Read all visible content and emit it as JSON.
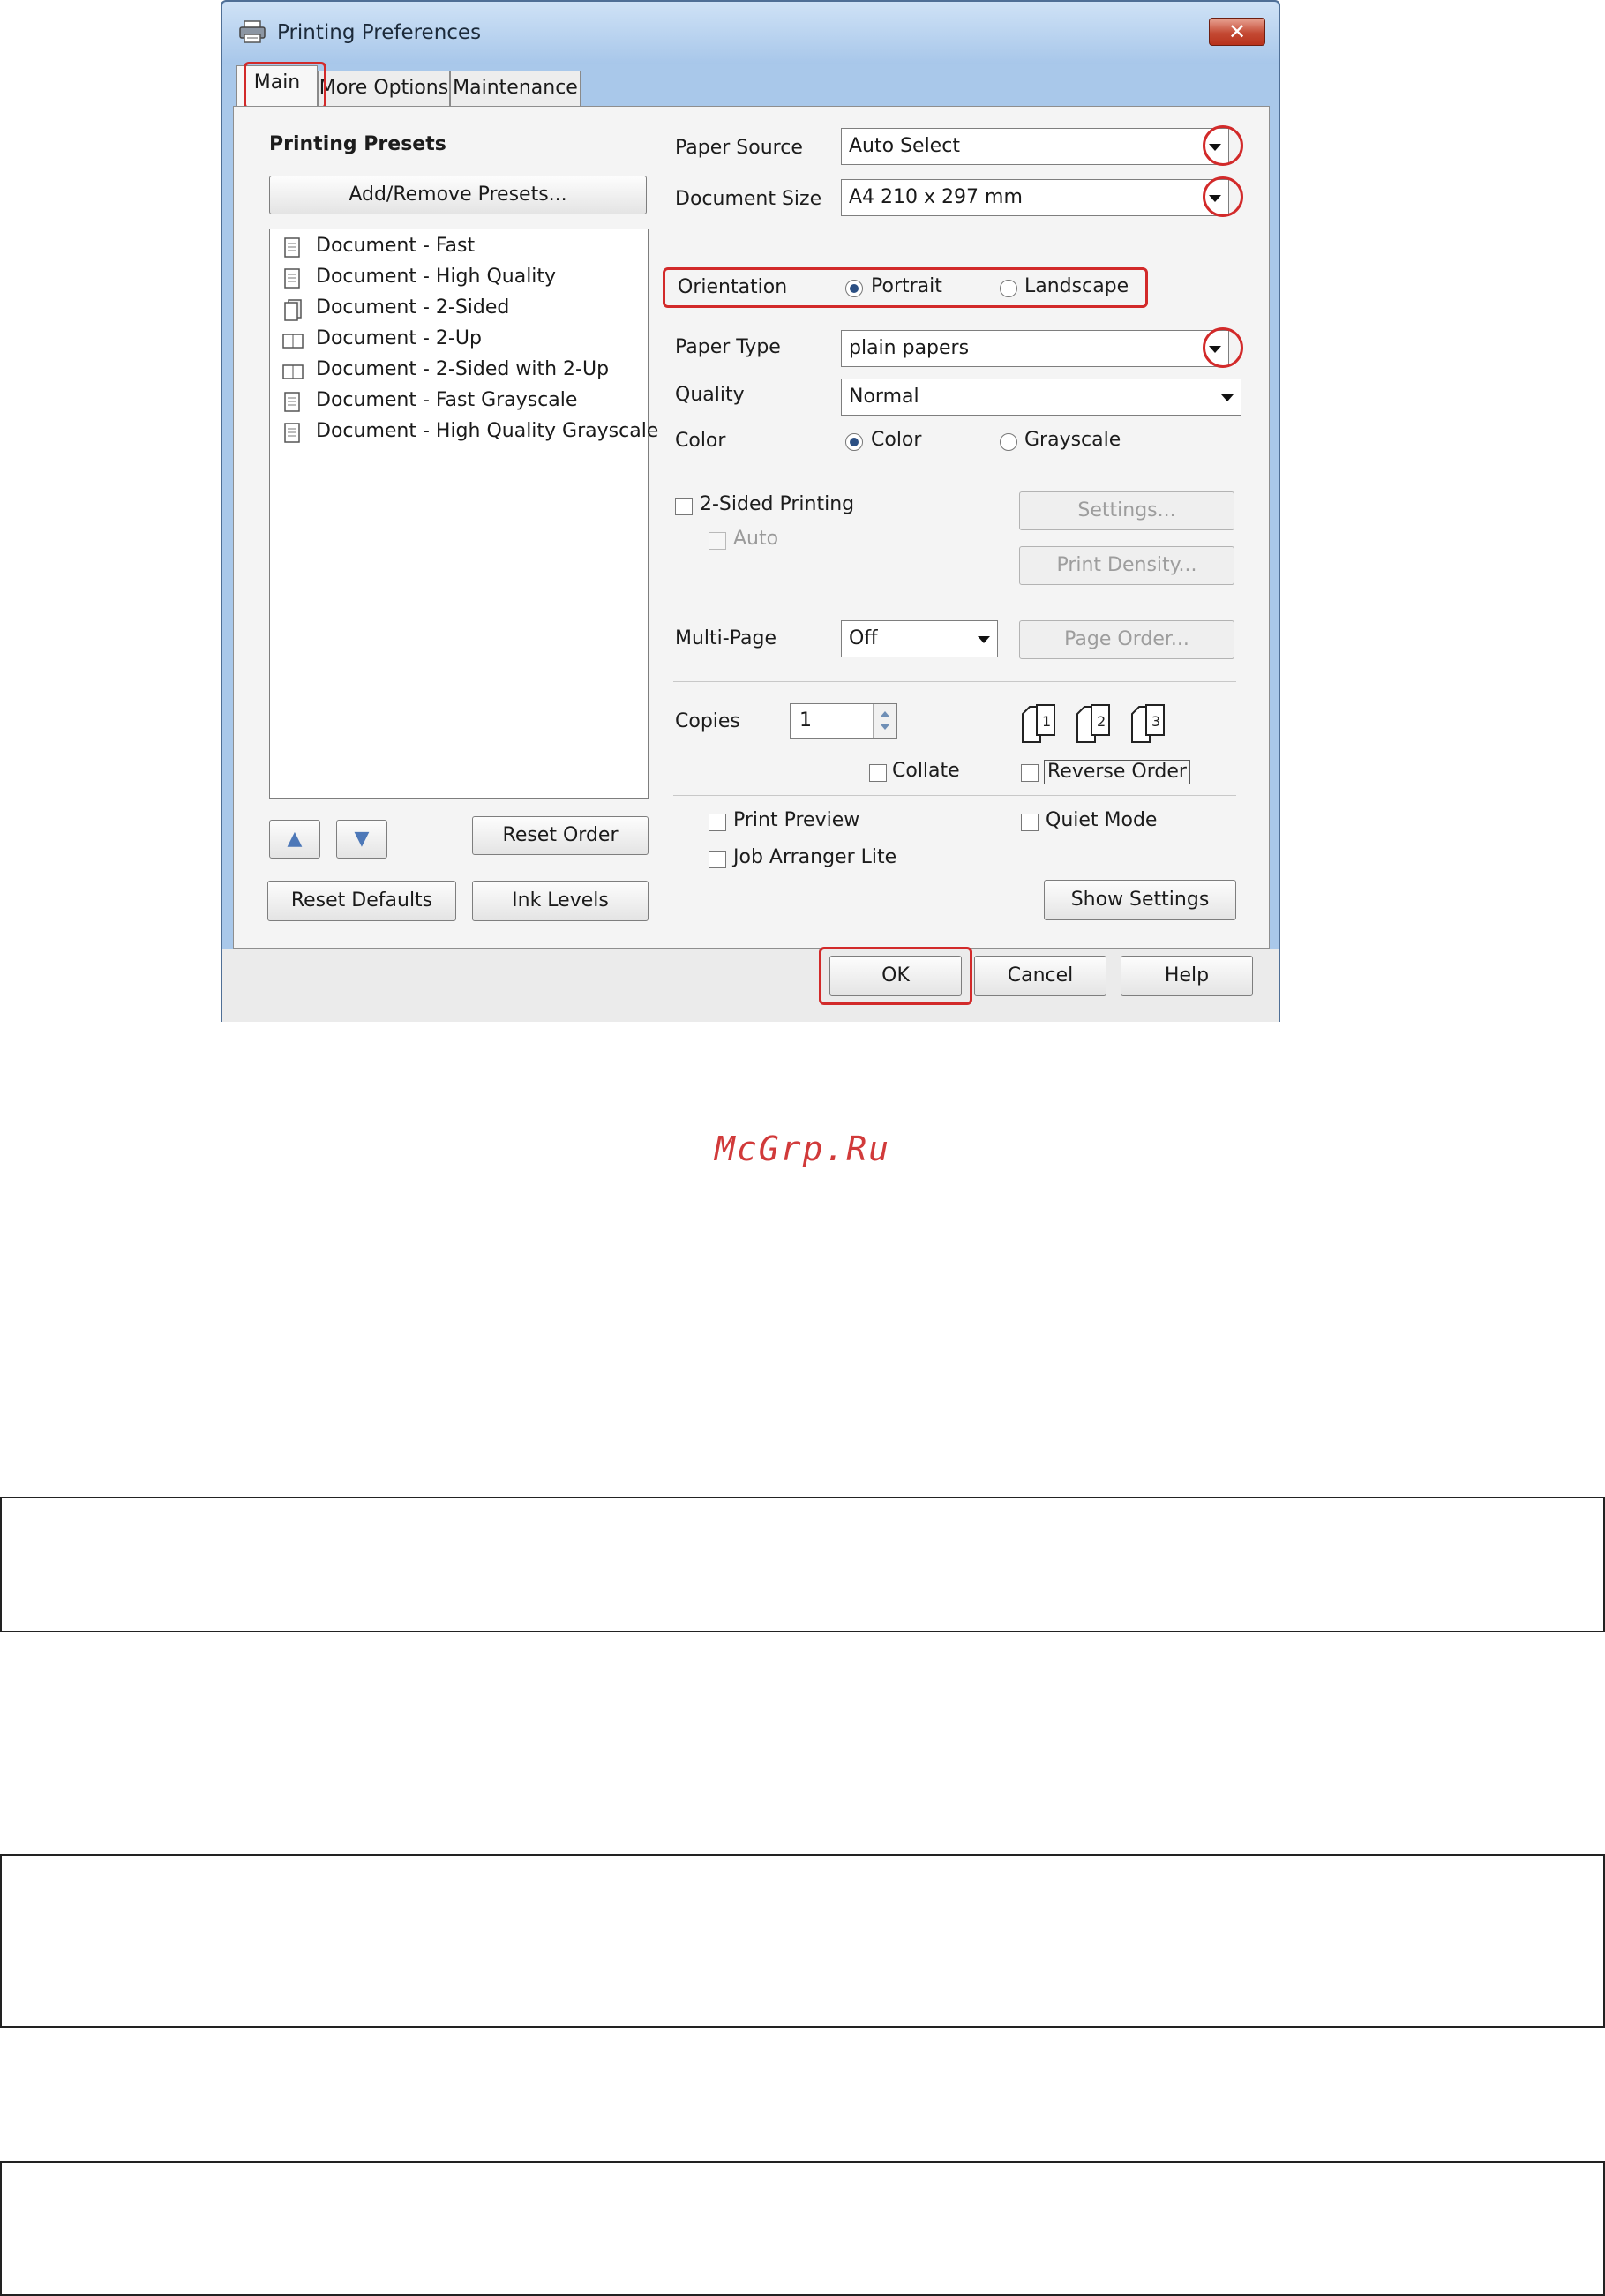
{
  "window": {
    "title": "Printing Preferences",
    "close_glyph": "✕",
    "close_color": "#c44a34",
    "highlight_color": "#d22a2a"
  },
  "tabs": [
    {
      "label": "Main",
      "active": true
    },
    {
      "label": "More Options",
      "active": false
    },
    {
      "label": "Maintenance",
      "active": false
    }
  ],
  "presets": {
    "heading": "Printing Presets",
    "add_remove_label": "Add/Remove Presets...",
    "items": [
      {
        "label": "Document - Fast",
        "icon": "document-icon"
      },
      {
        "label": "Document - High Quality",
        "icon": "document-icon"
      },
      {
        "label": "Document - 2-Sided",
        "icon": "two-sided-icon"
      },
      {
        "label": "Document - 2-Up",
        "icon": "two-up-icon"
      },
      {
        "label": "Document - 2-Sided with 2-Up",
        "icon": "two-up-icon"
      },
      {
        "label": "Document - Fast Grayscale",
        "icon": "document-icon"
      },
      {
        "label": "Document - High Quality Grayscale",
        "icon": "document-icon"
      }
    ],
    "move_up_glyph": "▲",
    "move_down_glyph": "▼",
    "reset_order_label": "Reset Order",
    "reset_defaults_label": "Reset Defaults",
    "ink_levels_label": "Ink Levels"
  },
  "settings": {
    "paper_source": {
      "label": "Paper Source",
      "value": "Auto Select"
    },
    "document_size": {
      "label": "Document Size",
      "value": "A4 210 x 297 mm"
    },
    "orientation": {
      "label": "Orientation",
      "options": [
        "Portrait",
        "Landscape"
      ],
      "selected": "Portrait"
    },
    "paper_type": {
      "label": "Paper Type",
      "value": "plain papers"
    },
    "quality": {
      "label": "Quality",
      "value": "Normal"
    },
    "color": {
      "label": "Color",
      "options": [
        "Color",
        "Grayscale"
      ],
      "selected": "Color"
    },
    "two_sided": {
      "label": "2-Sided Printing",
      "checked": false,
      "auto_label": "Auto",
      "auto_checked": false
    },
    "settings_button": "Settings...",
    "print_density_button": "Print Density...",
    "multi_page": {
      "label": "Multi-Page",
      "value": "Off"
    },
    "page_order_button": "Page Order...",
    "copies": {
      "label": "Copies",
      "value": "1"
    },
    "collate": {
      "label": "Collate",
      "checked": false
    },
    "reverse_order": {
      "label": "Reverse Order",
      "checked": false
    },
    "copy_icon_numbers": [
      "1",
      "2",
      "3"
    ],
    "print_preview": {
      "label": "Print Preview",
      "checked": false
    },
    "job_arranger": {
      "label": "Job Arranger Lite",
      "checked": false
    },
    "quiet_mode": {
      "label": "Quiet Mode",
      "checked": false
    },
    "show_settings_button": "Show Settings"
  },
  "footer": {
    "ok": "OK",
    "cancel": "Cancel",
    "help": "Help"
  },
  "watermark": "McGrp.Ru"
}
